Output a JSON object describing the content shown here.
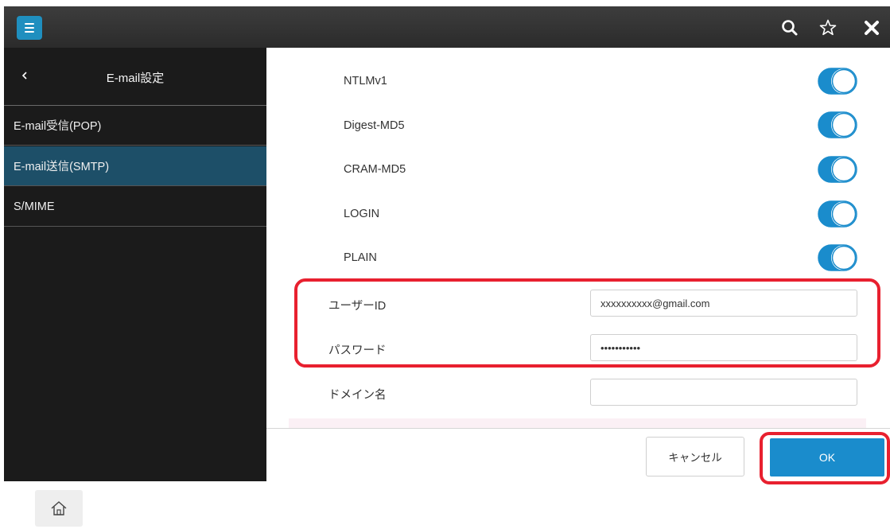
{
  "topbar": {
    "icons": [
      "menu-icon",
      "search-icon",
      "star-icon",
      "close-icon"
    ],
    "accent_color": "#1f8fbf"
  },
  "sidebar": {
    "title": "E-mail設定",
    "back_icon": "chevron-left-icon",
    "items": [
      {
        "label": "E-mail受信(POP)",
        "selected": false
      },
      {
        "label": "E-mail送信(SMTP)",
        "selected": true
      },
      {
        "label": "S/MIME",
        "selected": false
      }
    ]
  },
  "auth_methods": [
    {
      "label": "NTLMv1",
      "enabled": true
    },
    {
      "label": "Digest-MD5",
      "enabled": true
    },
    {
      "label": "CRAM-MD5",
      "enabled": true
    },
    {
      "label": "LOGIN",
      "enabled": true
    },
    {
      "label": "PLAIN",
      "enabled": true
    }
  ],
  "fields": {
    "user_id": {
      "label": "ユーザーID",
      "value": "xxxxxxxxxx@gmail.com"
    },
    "password": {
      "label": "パスワード",
      "value": "•••••••••••"
    },
    "domain": {
      "label": "ドメイン名",
      "value": ""
    }
  },
  "footer": {
    "cancel_label": "キャンセル",
    "ok_label": "OK"
  },
  "colors": {
    "toggle_on": "#1a8ccc",
    "selected_item": "#1d4f68",
    "highlight": "#e8202f",
    "ok_button": "#1a8ccc"
  }
}
